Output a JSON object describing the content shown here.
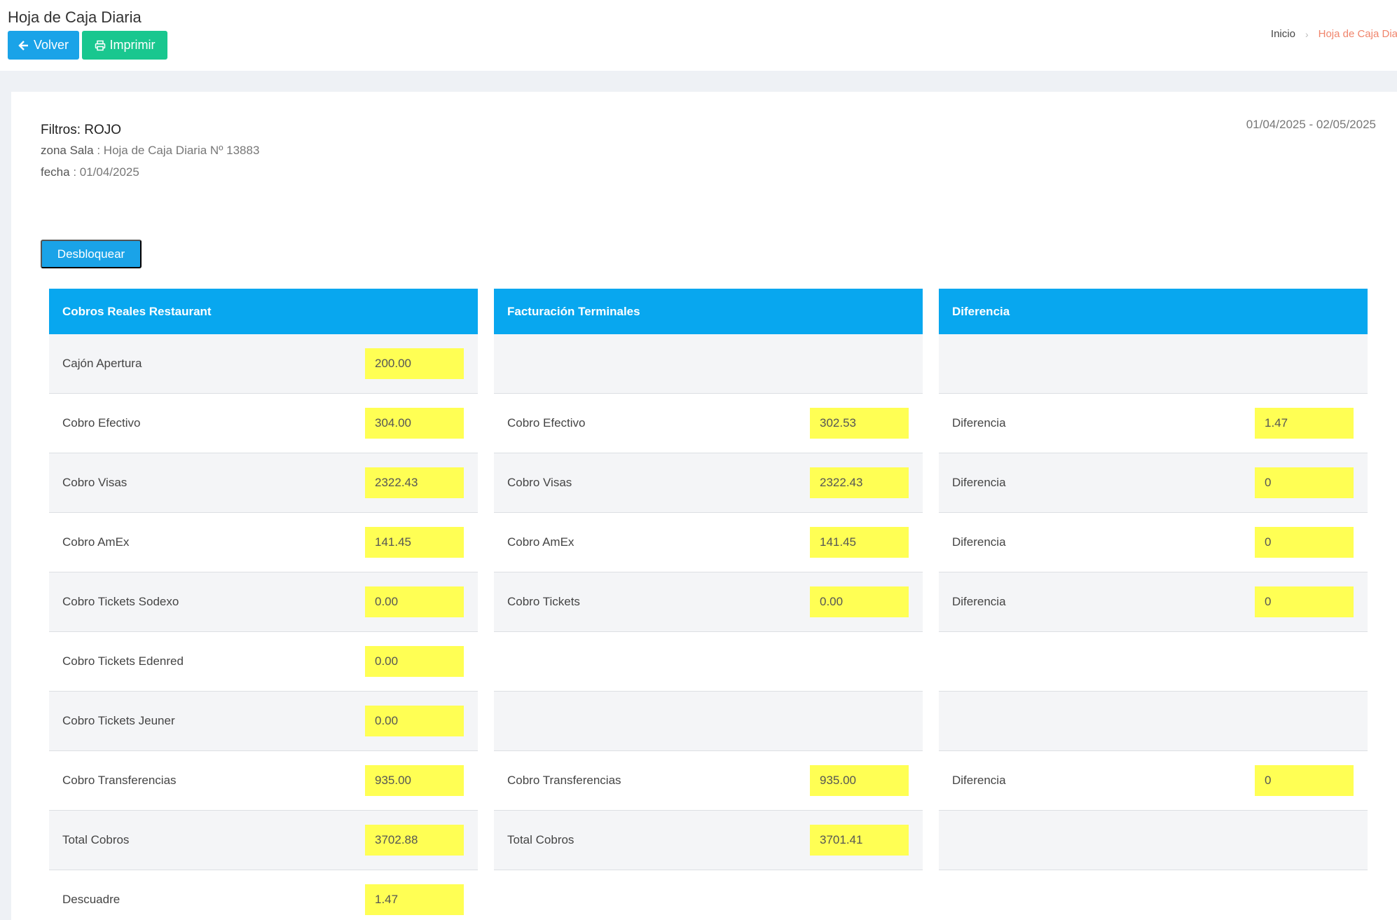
{
  "header": {
    "title": "Hoja de Caja Diaria",
    "back_label": "Volver",
    "print_label": "Imprimir",
    "breadcrumb": {
      "home": "Inicio",
      "current": "Hoja de Caja Diar"
    }
  },
  "filters": {
    "title": "Filtros: ROJO",
    "zona_key": "zona  Sala",
    "zona_value": " : Hoja de Caja Diaria Nº 13883",
    "fecha_key": "fecha",
    "fecha_value": " : 01/04/2025",
    "date_range": "01/04/2025 - 02/05/2025"
  },
  "unlock_label": "Desbloquear",
  "panels": [
    {
      "title": "Cobros Reales Restaurant",
      "rows": [
        {
          "label": "Cajón Apertura",
          "value": "200.00"
        },
        {
          "label": "Cobro Efectivo",
          "value": "304.00"
        },
        {
          "label": "Cobro Visas",
          "value": "2322.43"
        },
        {
          "label": "Cobro AmEx",
          "value": "141.45"
        },
        {
          "label": "Cobro Tickets Sodexo",
          "value": "0.00"
        },
        {
          "label": "Cobro Tickets Edenred",
          "value": "0.00"
        },
        {
          "label": "Cobro Tickets Jeuner",
          "value": "0.00"
        },
        {
          "label": "Cobro Transferencias",
          "value": "935.00"
        },
        {
          "label": "Total Cobros",
          "value": "3702.88"
        },
        {
          "label": "Descuadre",
          "value": "1.47"
        }
      ]
    },
    {
      "title": "Facturación Terminales",
      "rows": [
        {
          "label": "",
          "value": null
        },
        {
          "label": "Cobro Efectivo",
          "value": "302.53"
        },
        {
          "label": "Cobro Visas",
          "value": "2322.43"
        },
        {
          "label": "Cobro AmEx",
          "value": "141.45"
        },
        {
          "label": "Cobro Tickets",
          "value": "0.00"
        },
        {
          "label": "",
          "value": null
        },
        {
          "label": "",
          "value": null
        },
        {
          "label": "Cobro Transferencias",
          "value": "935.00"
        },
        {
          "label": "Total Cobros",
          "value": "3701.41"
        }
      ]
    },
    {
      "title": "Diferencia",
      "rows": [
        {
          "label": "",
          "value": null
        },
        {
          "label": "Diferencia",
          "value": "1.47"
        },
        {
          "label": "Diferencia",
          "value": "0"
        },
        {
          "label": "Diferencia",
          "value": "0"
        },
        {
          "label": "Diferencia",
          "value": "0"
        },
        {
          "label": "",
          "value": null
        },
        {
          "label": "",
          "value": null
        },
        {
          "label": "Diferencia",
          "value": "0"
        },
        {
          "label": "",
          "value": null
        }
      ]
    }
  ]
}
